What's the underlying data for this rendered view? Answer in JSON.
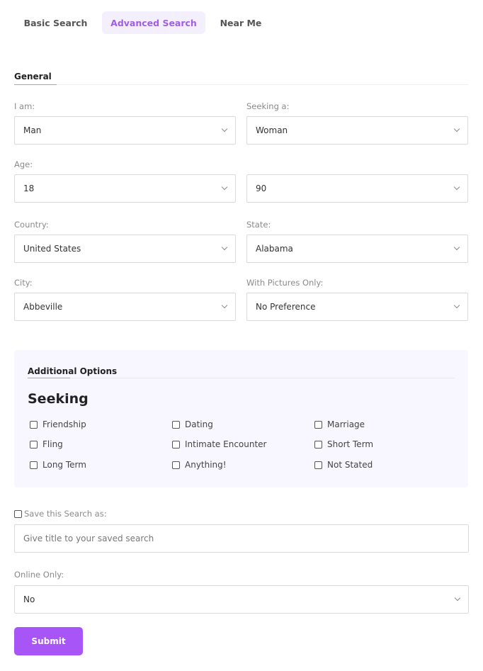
{
  "tabs": [
    {
      "label": "Basic Search"
    },
    {
      "label": "Advanced Search",
      "active": true
    },
    {
      "label": "Near Me"
    }
  ],
  "general": {
    "title": "General",
    "i_am_label": "I am:",
    "i_am_value": "Man",
    "seeking_label": "Seeking a:",
    "seeking_value": "Woman",
    "age_label": "Age:",
    "age_min": "18",
    "age_max": "90",
    "country_label": "Country:",
    "country_value": "United States",
    "state_label": "State:",
    "state_value": "Alabama",
    "city_label": "City:",
    "city_value": "Abbeville",
    "pictures_label": "With Pictures Only:",
    "pictures_value": "No Preference"
  },
  "additional": {
    "title": "Additional Options",
    "seeking_heading": "Seeking",
    "options": [
      {
        "label": "Friendship",
        "checked": false
      },
      {
        "label": "Dating",
        "checked": false
      },
      {
        "label": "Marriage",
        "checked": false
      },
      {
        "label": "Fling",
        "checked": false
      },
      {
        "label": "Intimate Encounter",
        "checked": false
      },
      {
        "label": "Short Term",
        "checked": false
      },
      {
        "label": "Long Term",
        "checked": false
      },
      {
        "label": "Anything!",
        "checked": false
      },
      {
        "label": "Not Stated",
        "checked": false
      }
    ]
  },
  "save": {
    "label": "Save this Search as:",
    "checked": false,
    "placeholder": "Give title to your saved search"
  },
  "online": {
    "label": "Online Only:",
    "value": "No"
  },
  "submit_label": "Submit",
  "colors": {
    "accent": "#a855f7",
    "active_tab_bg": "#f4effc",
    "options_bg": "#f8f6fe"
  },
  "icons": {
    "dropdown": "chevron-down-icon",
    "checkbox": "checkbox-icon"
  }
}
